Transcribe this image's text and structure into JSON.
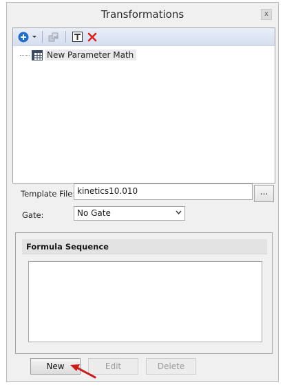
{
  "window": {
    "title": "Transformations",
    "close_label": "x"
  },
  "toolbar": {
    "items": [
      {
        "name": "add-icon",
        "glyph": "+"
      },
      {
        "name": "dropdown-arrow-icon",
        "glyph": "▾"
      },
      {
        "name": "duplicate-icon",
        "glyph": ""
      },
      {
        "name": "text-edit-icon",
        "glyph": "T"
      },
      {
        "name": "delete-icon",
        "glyph": "✕"
      }
    ],
    "colors": {
      "add": "#1f6fc9",
      "delete": "#d42020",
      "disabled": "#9aa3b3"
    }
  },
  "tree": {
    "items": [
      {
        "label": "New Parameter Math",
        "icon": "grid-table-icon"
      }
    ]
  },
  "form": {
    "template_label": "Template File:",
    "template_value": "kinetics10.010",
    "browse_label": "...",
    "gate_label": "Gate:",
    "gate_value": "No Gate"
  },
  "formula": {
    "header": "Formula Sequence"
  },
  "buttons": {
    "new": "New",
    "edit": "Edit",
    "delete": "Delete"
  },
  "annotation": {
    "arrow_color": "#c81e1e"
  }
}
